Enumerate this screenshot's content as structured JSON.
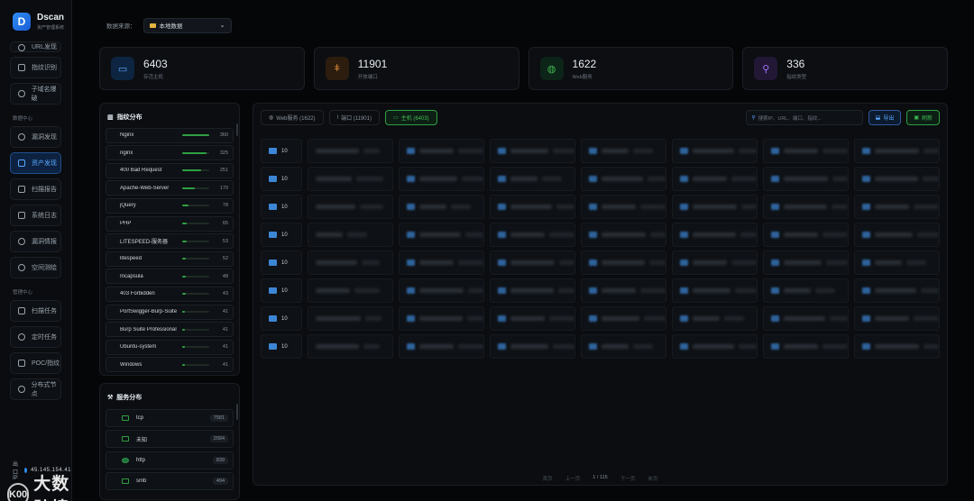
{
  "brand": {
    "name": "Dscan",
    "subtitle": "资产管理系统"
  },
  "sidebar": {
    "top_items": [
      {
        "label": "URL发现"
      },
      {
        "label": "指纹识别"
      },
      {
        "label": "子域名爆破"
      }
    ],
    "section1": "数据中心",
    "data_items": [
      {
        "label": "漏洞发现"
      },
      {
        "label": "资产发现"
      },
      {
        "label": "扫描报告"
      },
      {
        "label": "系统日志"
      },
      {
        "label": "漏洞情报"
      },
      {
        "label": "空间测绘"
      }
    ],
    "section2": "管理中心",
    "manage_items": [
      {
        "label": "扫描任务"
      },
      {
        "label": "定时任务"
      },
      {
        "label": "POC/指纹"
      },
      {
        "label": "分布式节点"
      }
    ],
    "exit_ip_label": "出口IP",
    "exit_ip": "45.145.154.41"
  },
  "watermark": {
    "logo": "K00",
    "text": "大数跨境"
  },
  "topbar": {
    "label": "数据来源：",
    "source": "本地数据"
  },
  "stats": [
    {
      "value": "6403",
      "label": "存活主机",
      "color": "#2f8df5",
      "icon": "monitor-icon"
    },
    {
      "value": "11901",
      "label": "开放端口",
      "color": "#d2883a",
      "icon": "plug-icon"
    },
    {
      "value": "1622",
      "label": "Web服务",
      "color": "#2ea043",
      "icon": "globe-icon"
    },
    {
      "value": "336",
      "label": "指纹类型",
      "color": "#a371f7",
      "icon": "search-icon"
    }
  ],
  "fingerprint": {
    "title": "指纹分布",
    "rows": [
      {
        "name": "Nginx",
        "count": 360,
        "pct": 1.0
      },
      {
        "name": "nginx",
        "count": 325,
        "pct": 0.9
      },
      {
        "name": "400 Bad Request",
        "count": 251,
        "pct": 0.7
      },
      {
        "name": "Apache-Web-Server",
        "count": 170,
        "pct": 0.47
      },
      {
        "name": "jQuery",
        "count": 78,
        "pct": 0.22
      },
      {
        "name": "PHP",
        "count": 65,
        "pct": 0.18
      },
      {
        "name": "LITESPEED-服务器",
        "count": 53,
        "pct": 0.15
      },
      {
        "name": "litespeed",
        "count": 52,
        "pct": 0.14
      },
      {
        "name": "Incapsula",
        "count": 48,
        "pct": 0.13
      },
      {
        "name": "403 Forbidden",
        "count": 43,
        "pct": 0.12
      },
      {
        "name": "PortSwigger-Burp-Suite",
        "count": 41,
        "pct": 0.11
      },
      {
        "name": "Burp Suite Professional",
        "count": 41,
        "pct": 0.11
      },
      {
        "name": "Ubuntu-system",
        "count": 41,
        "pct": 0.11
      },
      {
        "name": "Windows",
        "count": 41,
        "pct": 0.11
      }
    ]
  },
  "services": {
    "title": "服务分布",
    "rows": [
      {
        "name": "tcp",
        "count": "7581"
      },
      {
        "name": "未知",
        "count": "2094"
      },
      {
        "name": "http",
        "count": "839"
      },
      {
        "name": "smb",
        "count": "494"
      }
    ]
  },
  "table": {
    "tabs": [
      {
        "label": "Web服务 (1622)"
      },
      {
        "label": "端口 (11901)"
      },
      {
        "label": "主机 (6403)"
      }
    ],
    "search_placeholder": "搜索IP、URL、端口、指纹...",
    "export": "导出",
    "refresh": "刷新",
    "ip_prefix": "10",
    "row_count": 8
  },
  "pager": {
    "first": "首页",
    "prev": "上一页",
    "page": "1 / 115",
    "next": "下一页",
    "last": "末页"
  }
}
